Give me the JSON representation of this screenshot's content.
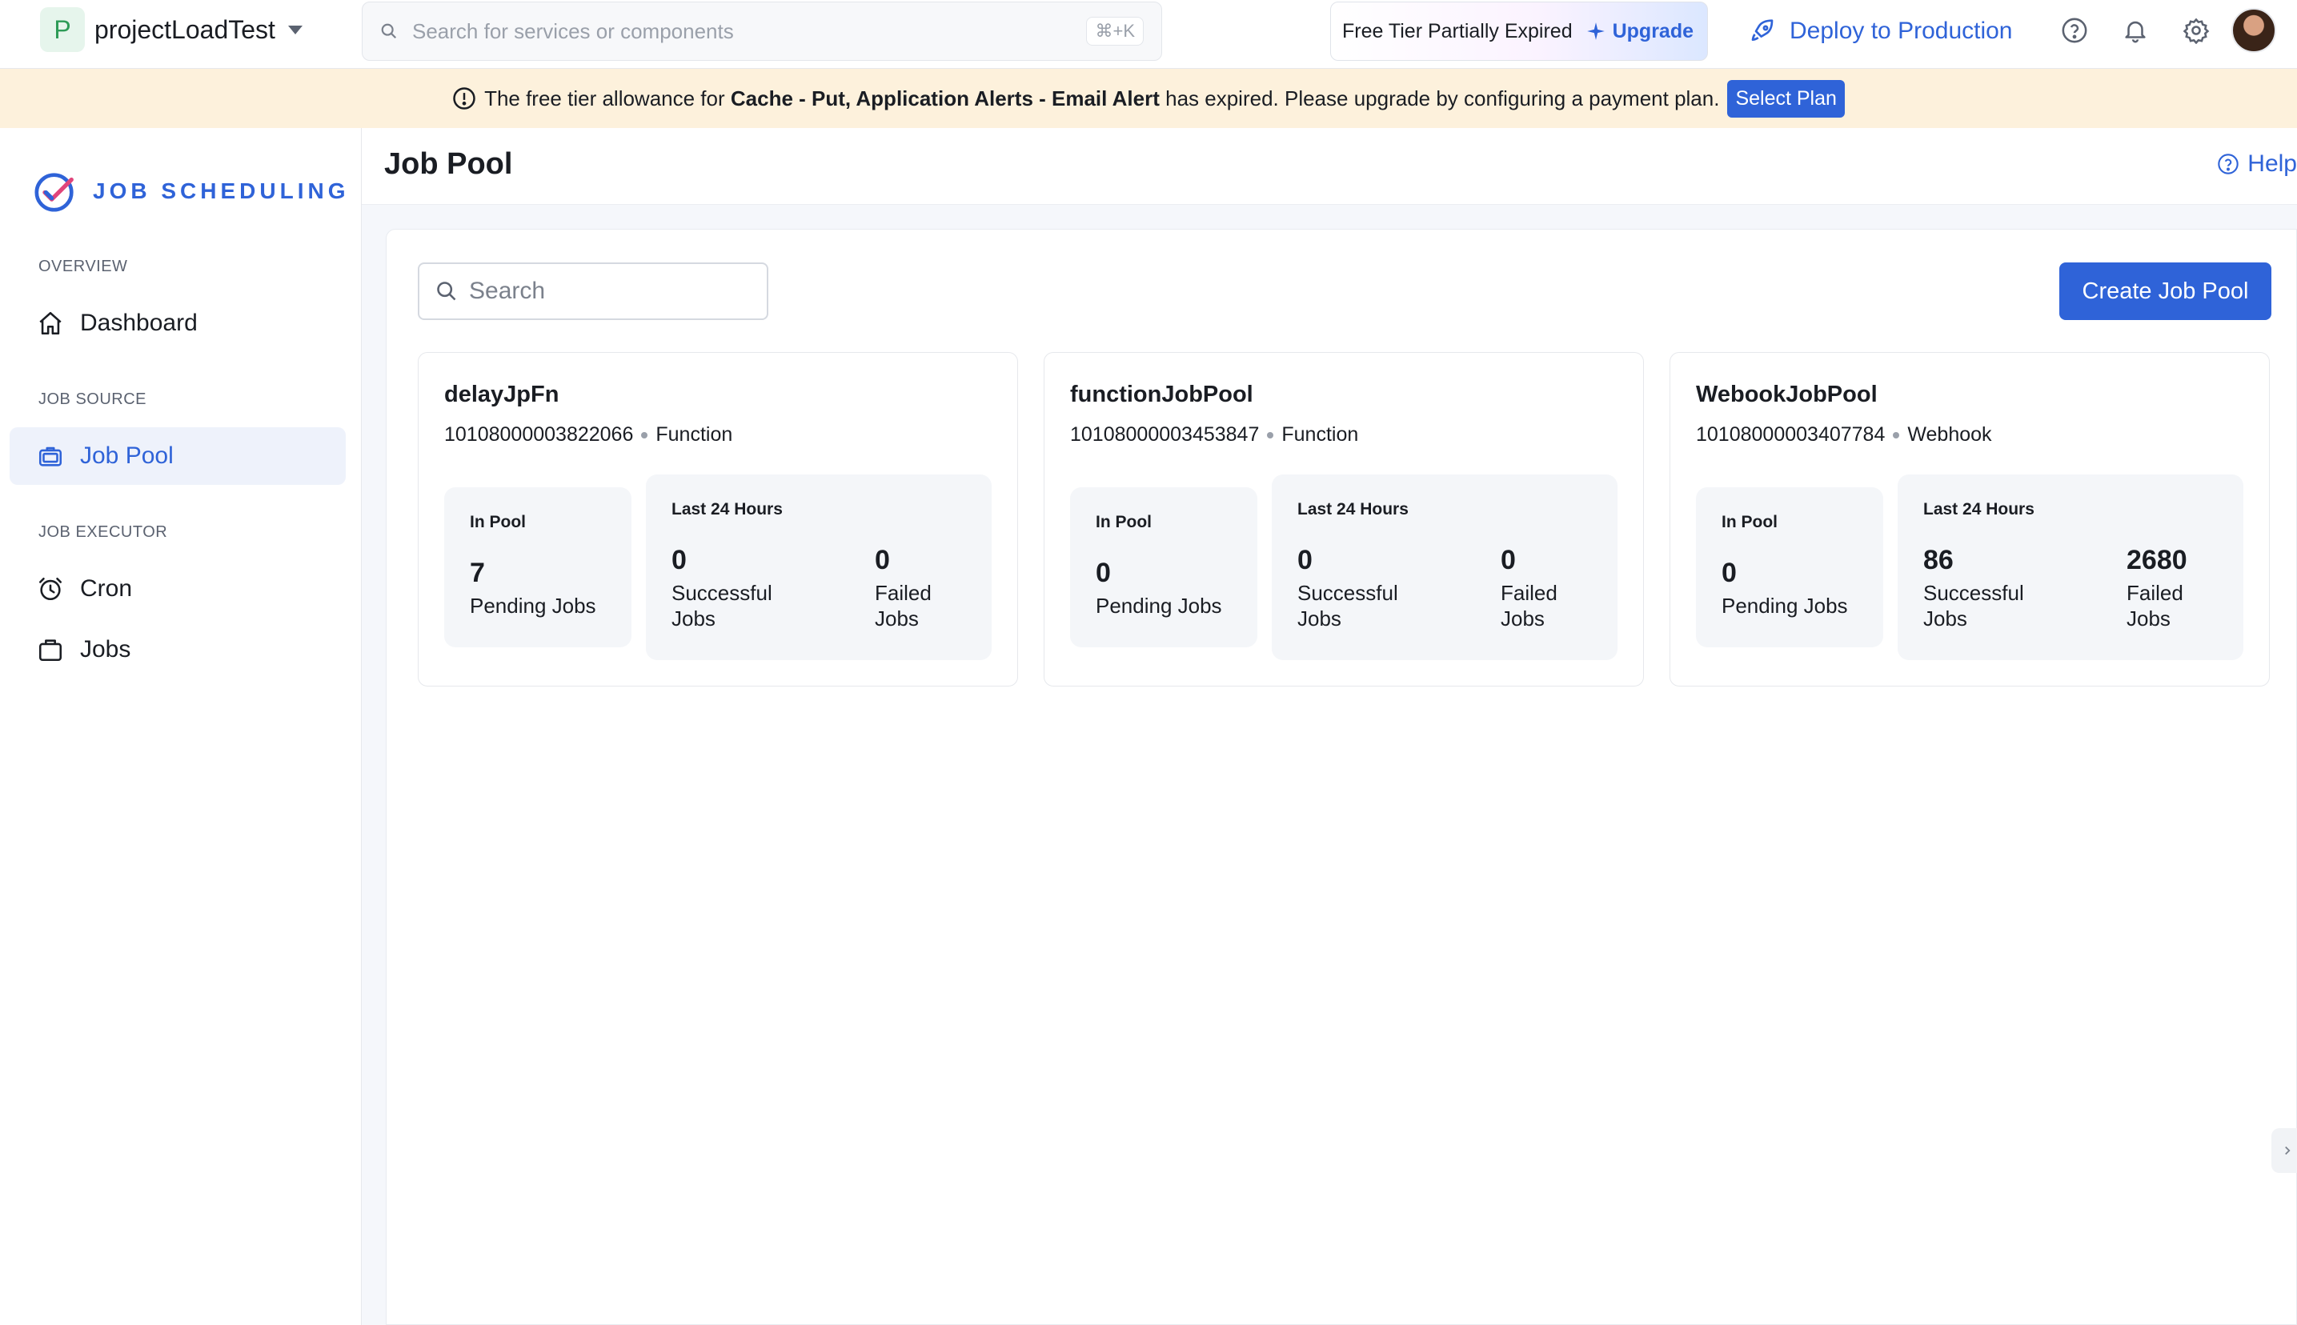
{
  "topbar": {
    "project_initial": "P",
    "project_name": "projectLoadTest",
    "search_placeholder": "Search for services or components",
    "search_shortcut": "⌘+K",
    "tier_status": "Free Tier Partially Expired",
    "upgrade_label": "Upgrade",
    "deploy_label": "Deploy to Production"
  },
  "banner": {
    "text_before": "The free tier allowance for",
    "services": "Cache - Put, Application Alerts - Email Alert",
    "text_after": "has expired. Please upgrade by configuring a payment plan.",
    "button_label": "Select Plan"
  },
  "sidebar": {
    "brand": "JOB SCHEDULING",
    "sections": [
      {
        "label": "OVERVIEW",
        "items": [
          {
            "label": "Dashboard",
            "icon": "home-icon",
            "active": false
          }
        ]
      },
      {
        "label": "JOB SOURCE",
        "items": [
          {
            "label": "Job Pool",
            "icon": "briefcase-icon",
            "active": true
          }
        ]
      },
      {
        "label": "JOB EXECUTOR",
        "items": [
          {
            "label": "Cron",
            "icon": "alarm-clock-icon",
            "active": false
          },
          {
            "label": "Jobs",
            "icon": "bag-icon",
            "active": false
          }
        ]
      }
    ]
  },
  "main": {
    "title": "Job Pool",
    "help_label": "Help",
    "search_placeholder": "Search",
    "create_label": "Create Job Pool"
  },
  "pools": [
    {
      "name": "delayJpFn",
      "id": "10108000003822066",
      "type": "Function",
      "in_pool_title": "In Pool",
      "pending": "7",
      "pending_label": "Pending Jobs",
      "last_title": "Last 24 Hours",
      "successful": "0",
      "successful_label": "Successful Jobs",
      "failed": "0",
      "failed_label": "Failed Jobs"
    },
    {
      "name": "functionJobPool",
      "id": "10108000003453847",
      "type": "Function",
      "in_pool_title": "In Pool",
      "pending": "0",
      "pending_label": "Pending Jobs",
      "last_title": "Last 24 Hours",
      "successful": "0",
      "successful_label": "Successful Jobs",
      "failed": "0",
      "failed_label": "Failed Jobs"
    },
    {
      "name": "WebookJobPool",
      "id": "10108000003407784",
      "type": "Webhook",
      "in_pool_title": "In Pool",
      "pending": "0",
      "pending_label": "Pending Jobs",
      "last_title": "Last 24 Hours",
      "successful": "86",
      "successful_label": "Successful Jobs",
      "failed": "2680",
      "failed_label": "Failed Jobs"
    }
  ],
  "colors": {
    "accent": "#2f63d8",
    "banner_bg": "#fdf1dc",
    "card_box_bg": "#f4f6f9"
  }
}
